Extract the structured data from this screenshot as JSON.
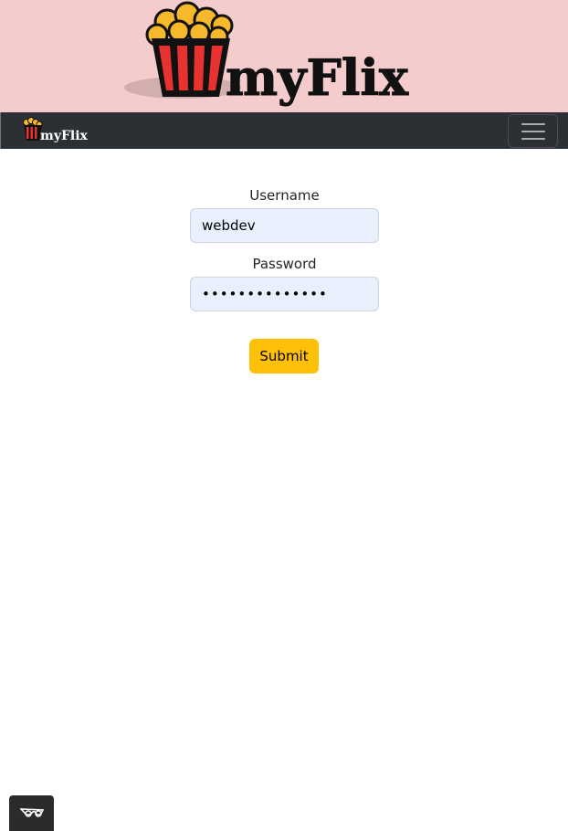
{
  "banner": {
    "logo_text": "myFlix",
    "colors": {
      "background": "#f4cccc",
      "popcorn_box": "#e8322f",
      "popcorn": "#f6b92b",
      "text": "#111111"
    }
  },
  "navbar": {
    "brand_text": "myFlix",
    "toggler_icon": "hamburger-icon",
    "colors": {
      "background": "#2b3035"
    }
  },
  "login_form": {
    "username_label": "Username",
    "username_value": "webdev",
    "password_label": "Password",
    "password_value": "••••••••••••••",
    "submit_label": "Submit"
  },
  "corner_widget": {
    "icon": "glasses-icon"
  },
  "theme": {
    "accent": "#ffc107",
    "input_bg": "#e8f0fe"
  }
}
